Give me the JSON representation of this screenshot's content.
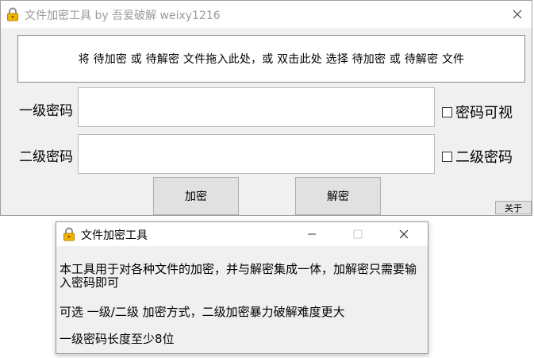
{
  "main_window": {
    "title": "文件加密工具 by 吾爱破解 weixy1216",
    "close_glyph": "✕",
    "drop_zone_text": "将 待加密 或 待解密 文件拖入此处，或 双击此处 选择 待加密 或 待解密 文件",
    "level1": {
      "label": "一级密码",
      "value": "",
      "checkbox_label": "密码可视",
      "checked": false
    },
    "level2": {
      "label": "二级密码",
      "value": "",
      "checkbox_label": "二级密码",
      "checked": false
    },
    "encrypt_button": "加密",
    "decrypt_button": "解密",
    "about_button": "关于"
  },
  "about_dialog": {
    "title": "文件加密工具",
    "lines": [
      "本工具用于对各种文件的加密，并与解密集成一体，加解密只需要输入密码即可",
      "可选 一级/二级 加密方式，二级加密暴力破解难度更大",
      "一级密码长度至少8位"
    ]
  },
  "colors": {
    "lock_icon": "#f0b400",
    "button_face": "#e1e1e1",
    "window_bg": "#f0f0f0"
  }
}
